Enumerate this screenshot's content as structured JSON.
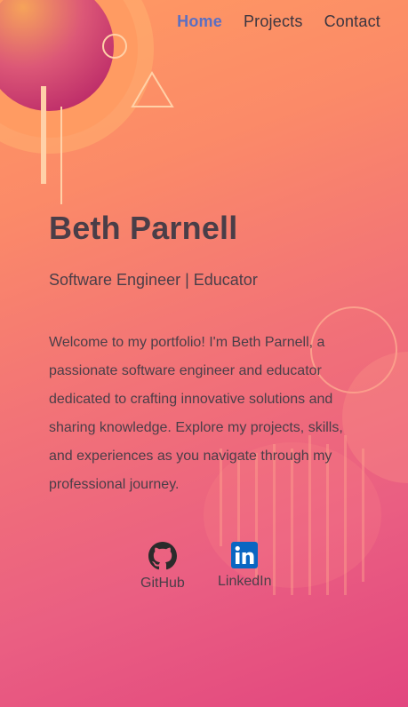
{
  "nav": {
    "items": [
      {
        "label": "Home",
        "active": true
      },
      {
        "label": "Projects",
        "active": false
      },
      {
        "label": "Contact",
        "active": false
      }
    ]
  },
  "hero": {
    "name": "Beth Parnell",
    "subtitle": "Software Engineer | Educator",
    "intro": "Welcome to my portfolio! I'm Beth Parnell, a passionate software engineer and educator dedicated to crafting innovative solutions and sharing knowledge. Explore my projects, skills, and experiences as you navigate through my professional journey."
  },
  "social": {
    "github": {
      "label": "GitHub",
      "icon": "github-icon"
    },
    "linkedin": {
      "label": "LinkedIn",
      "icon": "linkedin-icon"
    }
  },
  "colors": {
    "accent": "#5b6fc2",
    "text": "#4a3e48",
    "gradient_start": "#ff9a62",
    "gradient_end": "#e2467f",
    "linkedin_blue": "#0a66c2"
  }
}
